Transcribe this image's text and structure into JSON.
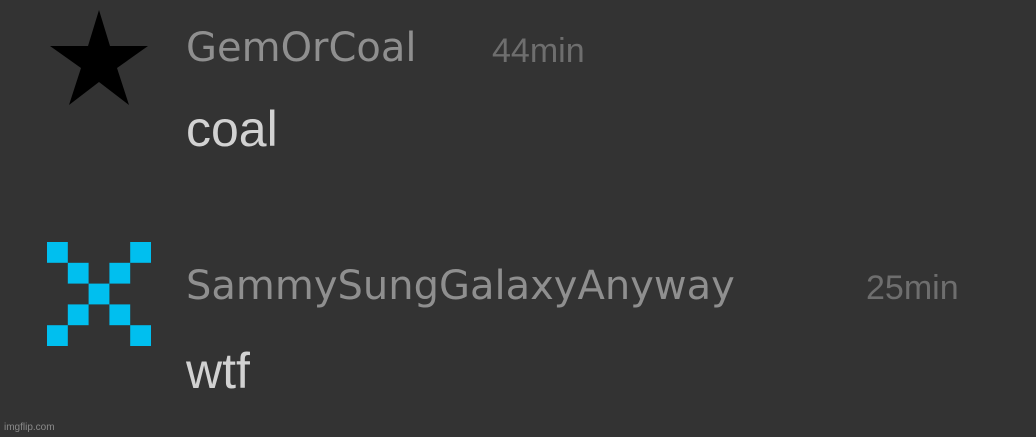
{
  "comments": [
    {
      "username": "GemOrCoal",
      "time": "44min",
      "message": "coal",
      "avatar": {
        "icon": "black-star-icon",
        "color": "#000000"
      }
    },
    {
      "username": "SammySungGalaxyAnyway",
      "time": "25min",
      "message": "wtf",
      "avatar": {
        "icon": "pixel-x-icon",
        "color": "#00bfef"
      }
    }
  ],
  "watermark": "imgflip.com",
  "colors": {
    "background": "#333333",
    "username": "#8f8f8f",
    "time": "#6e6e6e",
    "message": "#d2d2d2"
  }
}
